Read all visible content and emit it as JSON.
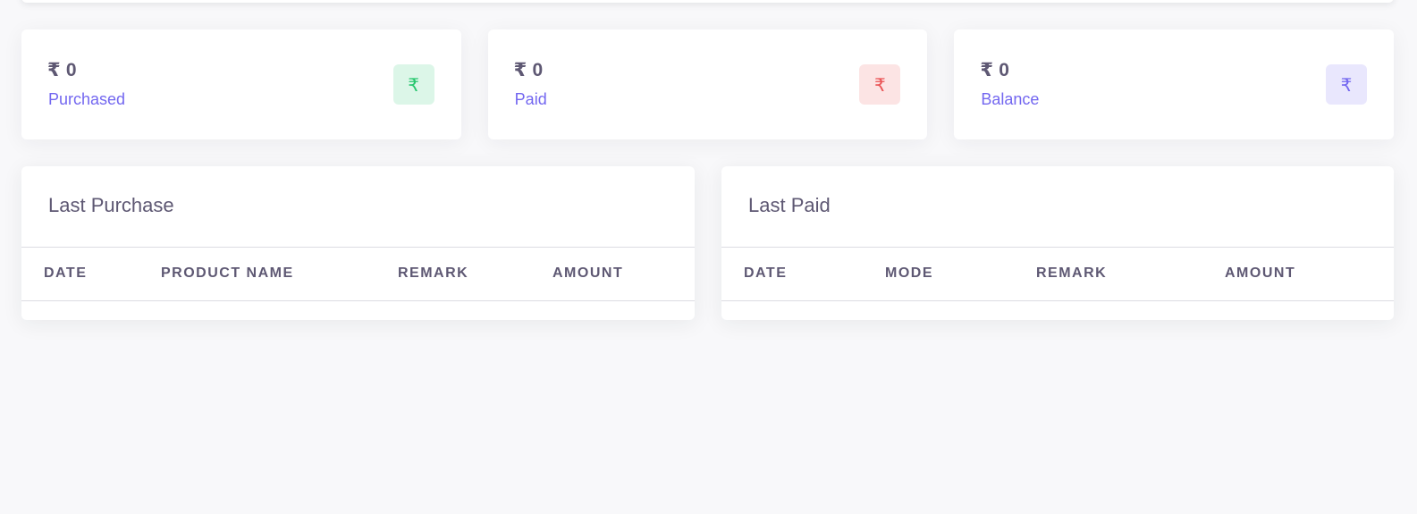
{
  "stats": [
    {
      "value": "₹ 0",
      "label": "Purchased",
      "icon": "rupee-icon",
      "color": "#28c76f"
    },
    {
      "value": "₹ 0",
      "label": "Paid",
      "icon": "rupee-icon",
      "color": "#ea5455"
    },
    {
      "value": "₹ 0",
      "label": "Balance",
      "icon": "rupee-icon",
      "color": "#7367f0"
    }
  ],
  "icon_glyph": "₹",
  "last_purchase": {
    "title": "Last Purchase",
    "columns": [
      "DATE",
      "PRODUCT NAME",
      "REMARK",
      "AMOUNT"
    ],
    "rows": []
  },
  "last_paid": {
    "title": "Last Paid",
    "columns": [
      "DATE",
      "MODE",
      "REMARK",
      "AMOUNT"
    ],
    "rows": []
  }
}
